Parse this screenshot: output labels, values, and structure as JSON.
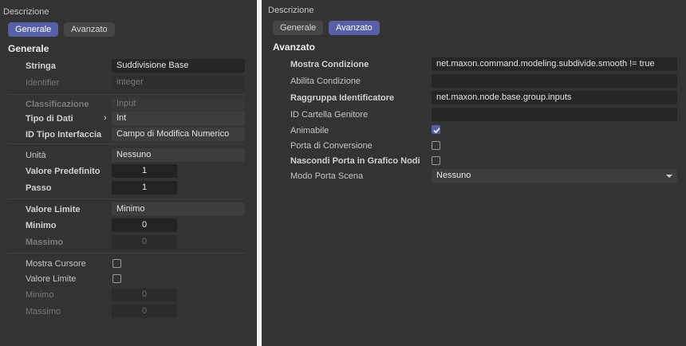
{
  "left": {
    "title": "Descrizione",
    "tabs": [
      {
        "label": "Generale",
        "active": true
      },
      {
        "label": "Avanzato",
        "active": false
      }
    ],
    "section": "Generale",
    "rows": {
      "stringa": {
        "label": "Stringa",
        "value": "Suddivisione Base"
      },
      "identifier": {
        "label": "Identifier",
        "value": "integer"
      },
      "classificazione": {
        "label": "Classificazione",
        "value": "Input"
      },
      "tipo_dati": {
        "label": "Tipo di Dati",
        "value": "Int"
      },
      "id_tipo_interfaccia": {
        "label": "ID Tipo Interfaccia",
        "value": "Campo di Modifica Numerico"
      },
      "unita": {
        "label": "Unità",
        "value": "Nessuno"
      },
      "valore_predefinito": {
        "label": "Valore Predefinito",
        "value": "1"
      },
      "passo": {
        "label": "Passo",
        "value": "1"
      },
      "valore_limite": {
        "label": "Valore Limite",
        "value": "Minimo"
      },
      "minimo": {
        "label": "Minimo",
        "value": "0"
      },
      "massimo": {
        "label": "Massimo",
        "value": "0"
      },
      "mostra_cursore": {
        "label": "Mostra Cursore",
        "checked": false
      },
      "valore_limite_2": {
        "label": "Valore Limite",
        "checked": false
      },
      "minimo_2": {
        "label": "Minimo",
        "value": "0"
      },
      "massimo_2": {
        "label": "Massimo",
        "value": "0"
      }
    }
  },
  "right": {
    "title": "Descrizione",
    "tabs": [
      {
        "label": "Generale",
        "active": false
      },
      {
        "label": "Avanzato",
        "active": true
      }
    ],
    "section": "Avanzato",
    "rows": {
      "mostra_condizione": {
        "label": "Mostra Condizione",
        "value": "net.maxon.command.modeling.subdivide.smooth != true"
      },
      "abilita_condizione": {
        "label": "Abilita Condizione",
        "value": ""
      },
      "raggruppa_identificatore": {
        "label": "Raggruppa Identificatore",
        "value": "net.maxon.node.base.group.inputs"
      },
      "id_cartella_genitore": {
        "label": "ID Cartella Genitore",
        "value": ""
      },
      "animabile": {
        "label": "Animabile",
        "checked": true
      },
      "porta_conversione": {
        "label": "Porta di Conversione",
        "checked": false
      },
      "nascondi_porta": {
        "label": "Nascondi Porta in Grafico Nodi",
        "checked": false
      },
      "modo_porta_scena": {
        "label": "Modo Porta Scena",
        "value": "Nessuno"
      }
    }
  },
  "colors": {
    "accent": "#5560a8",
    "panel": "#333333",
    "field": "#262626"
  }
}
